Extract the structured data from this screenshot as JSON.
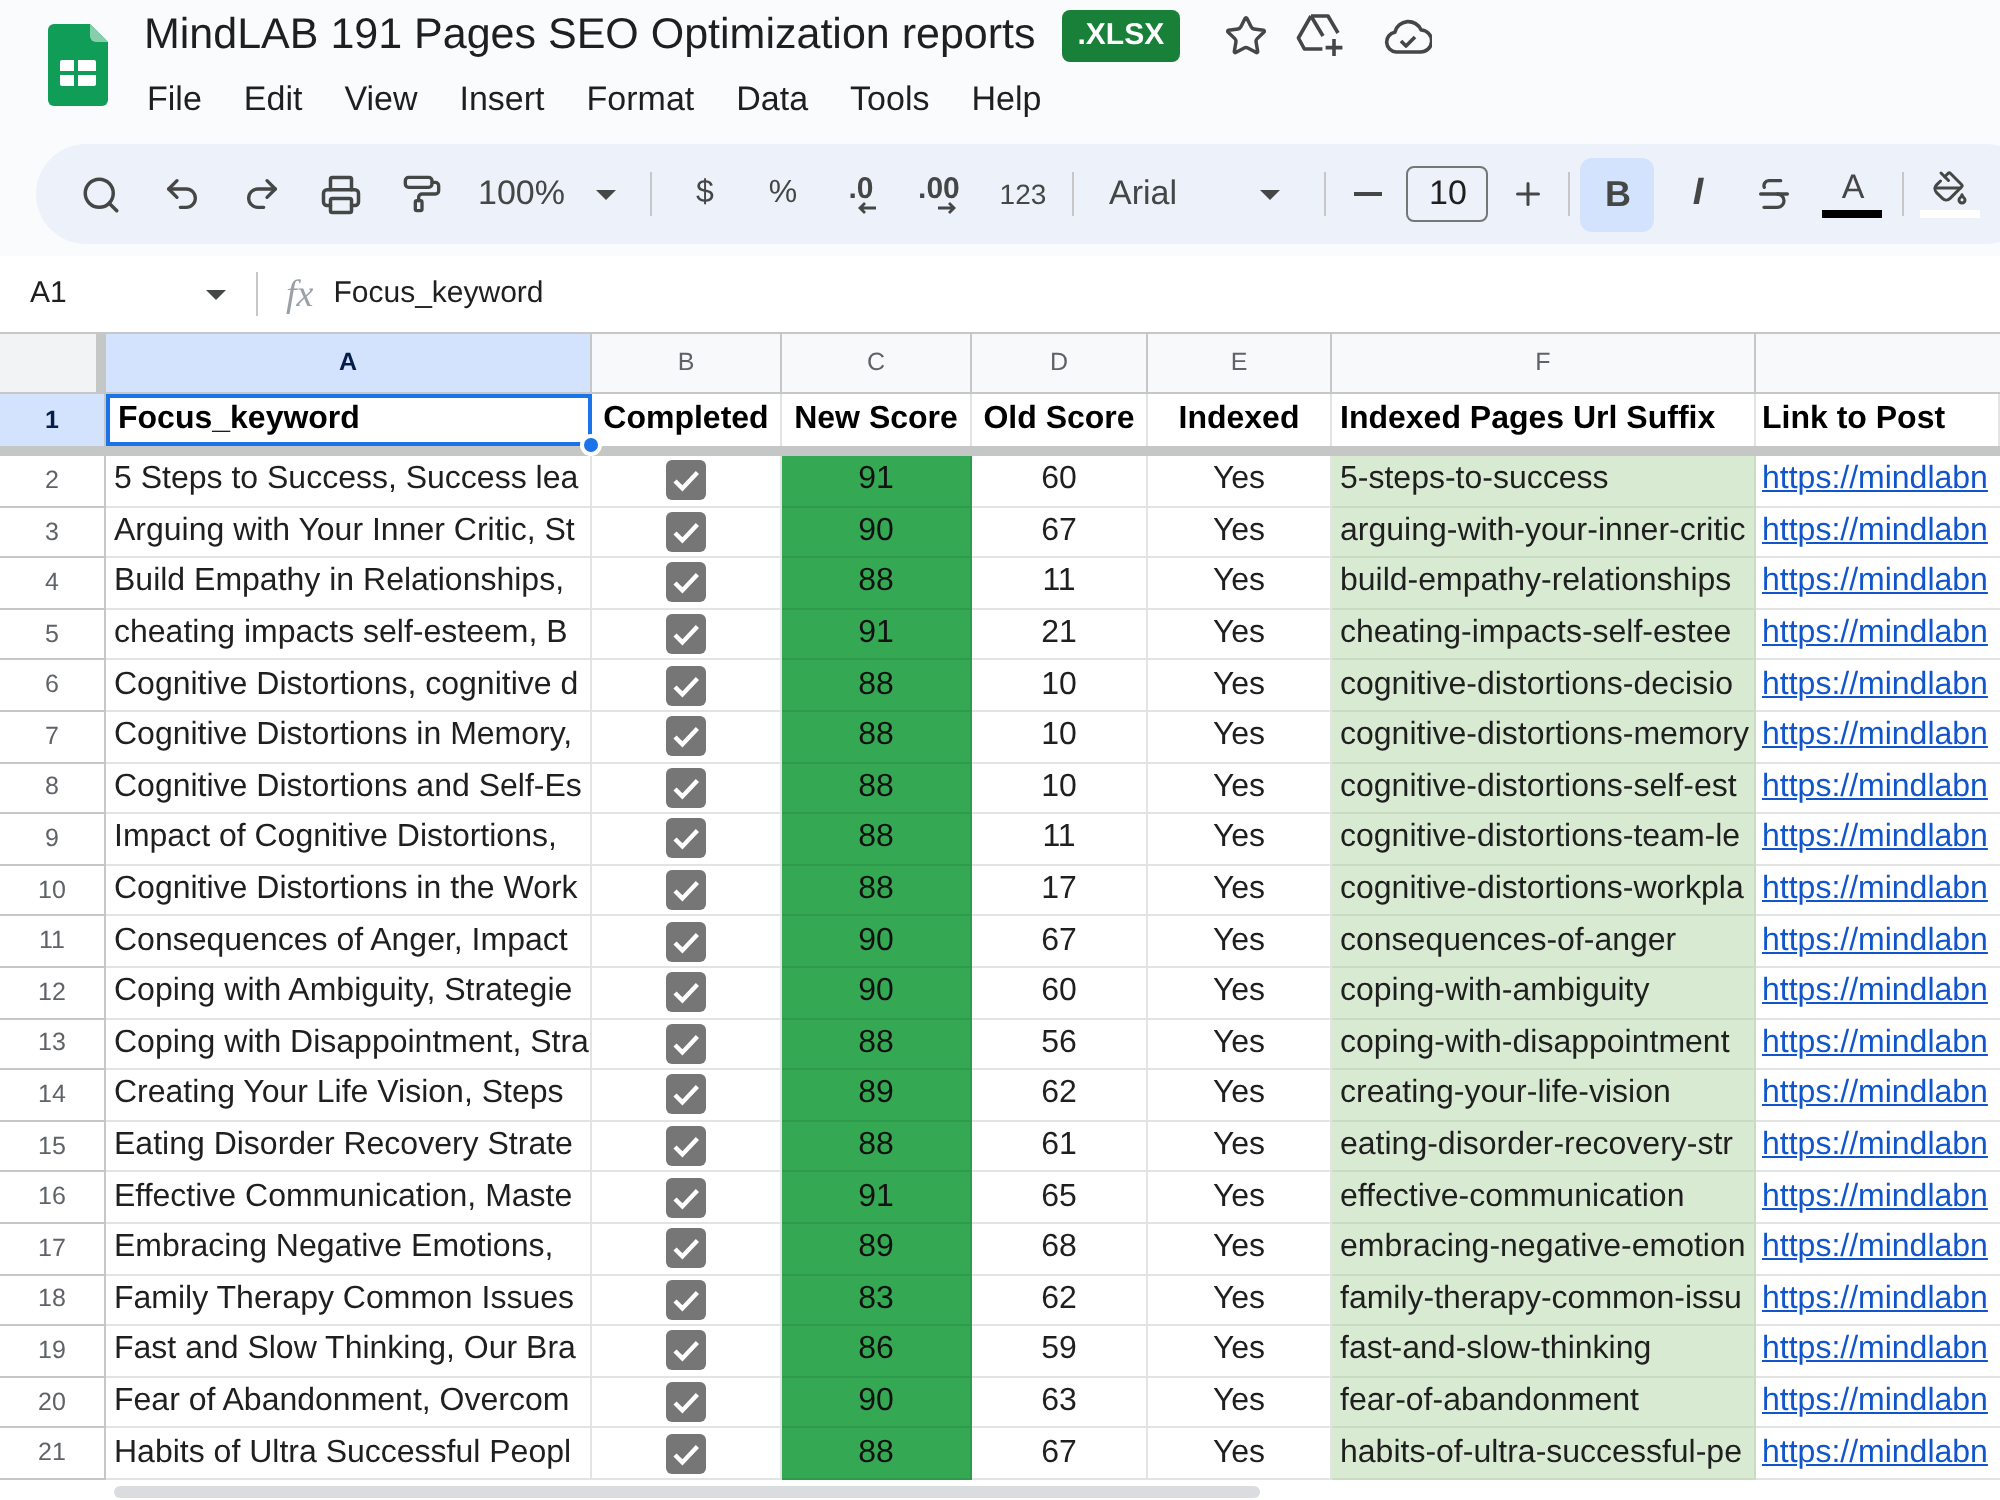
{
  "app": {
    "title": "MindLAB 191 Pages SEO Optimization reports",
    "file_badge": ".XLSX"
  },
  "menu": [
    "File",
    "Edit",
    "View",
    "Insert",
    "Format",
    "Data",
    "Tools",
    "Help"
  ],
  "toolbar": {
    "zoom": "100%",
    "currency": "$",
    "percent": "%",
    "decrease_decimal": ".0",
    "increase_decimal": ".00",
    "number_formats": "123",
    "font": "Arial",
    "font_size": "10",
    "bold": {
      "label": "B",
      "selected": true
    },
    "italic": {
      "label": "I",
      "selected": false
    },
    "strikethrough": {
      "selected": false
    },
    "text_color": "A"
  },
  "formula_bar": {
    "cell_ref": "A1",
    "function_label": "fx",
    "content": "Focus_keyword"
  },
  "sheet": {
    "columns": [
      {
        "letter": "A",
        "selected": true
      },
      {
        "letter": "B",
        "selected": false
      },
      {
        "letter": "C",
        "selected": false
      },
      {
        "letter": "D",
        "selected": false
      },
      {
        "letter": "E",
        "selected": false
      },
      {
        "letter": "F",
        "selected": false
      }
    ],
    "header_row": {
      "number": "1",
      "selected": true,
      "cells": [
        {
          "text": "Focus_keyword",
          "selected": true
        },
        {
          "text": "Completed",
          "selected": false
        },
        {
          "text": "New Score",
          "selected": false
        },
        {
          "text": "Old Score",
          "selected": false
        },
        {
          "text": "Indexed",
          "selected": false
        },
        {
          "text": "Indexed Pages Url Suffix",
          "selected": false
        },
        {
          "text": "Link to Post",
          "selected": false
        }
      ]
    },
    "rows": [
      {
        "number": "2",
        "selected": false,
        "keyword": "5 Steps to Success, Success lea",
        "completed": true,
        "new_score": "91",
        "old_score": "60",
        "indexed": "Yes",
        "url_suffix": "5-steps-to-success",
        "link": "https://mindlabn"
      },
      {
        "number": "3",
        "selected": false,
        "keyword": "Arguing with Your Inner Critic, St",
        "completed": true,
        "new_score": "90",
        "old_score": "67",
        "indexed": "Yes",
        "url_suffix": "arguing-with-your-inner-critic",
        "link": "https://mindlabn"
      },
      {
        "number": "4",
        "selected": false,
        "keyword": "Build Empathy in Relationships,",
        "completed": true,
        "new_score": "88",
        "old_score": "11",
        "indexed": "Yes",
        "url_suffix": "build-empathy-relationships",
        "link": "https://mindlabn"
      },
      {
        "number": "5",
        "selected": false,
        "keyword": "cheating impacts self-esteem, B",
        "completed": true,
        "new_score": "91",
        "old_score": "21",
        "indexed": "Yes",
        "url_suffix": "cheating-impacts-self-estee",
        "link": "https://mindlabn"
      },
      {
        "number": "6",
        "selected": false,
        "keyword": "Cognitive Distortions, cognitive d",
        "completed": true,
        "new_score": "88",
        "old_score": "10",
        "indexed": "Yes",
        "url_suffix": "cognitive-distortions-decisio",
        "link": "https://mindlabn"
      },
      {
        "number": "7",
        "selected": false,
        "keyword": "Cognitive Distortions in Memory,",
        "completed": true,
        "new_score": "88",
        "old_score": "10",
        "indexed": "Yes",
        "url_suffix": "cognitive-distortions-memory",
        "link": "https://mindlabn"
      },
      {
        "number": "8",
        "selected": false,
        "keyword": "Cognitive Distortions and Self-Es",
        "completed": true,
        "new_score": "88",
        "old_score": "10",
        "indexed": "Yes",
        "url_suffix": "cognitive-distortions-self-est",
        "link": "https://mindlabn"
      },
      {
        "number": "9",
        "selected": false,
        "keyword": "Impact of Cognitive Distortions,",
        "completed": true,
        "new_score": "88",
        "old_score": "11",
        "indexed": "Yes",
        "url_suffix": "cognitive-distortions-team-le",
        "link": "https://mindlabn"
      },
      {
        "number": "10",
        "selected": false,
        "keyword": "Cognitive Distortions in the Work",
        "completed": true,
        "new_score": "88",
        "old_score": "17",
        "indexed": "Yes",
        "url_suffix": "cognitive-distortions-workpla",
        "link": "https://mindlabn"
      },
      {
        "number": "11",
        "selected": false,
        "keyword": "Consequences of Anger, Impact",
        "completed": true,
        "new_score": "90",
        "old_score": "67",
        "indexed": "Yes",
        "url_suffix": "consequences-of-anger",
        "link": "https://mindlabn"
      },
      {
        "number": "12",
        "selected": false,
        "keyword": "Coping with Ambiguity, Strategie",
        "completed": true,
        "new_score": "90",
        "old_score": "60",
        "indexed": "Yes",
        "url_suffix": "coping-with-ambiguity",
        "link": "https://mindlabn"
      },
      {
        "number": "13",
        "selected": false,
        "keyword": "Coping with Disappointment, Stra",
        "completed": true,
        "new_score": "88",
        "old_score": "56",
        "indexed": "Yes",
        "url_suffix": "coping-with-disappointment",
        "link": "https://mindlabn"
      },
      {
        "number": "14",
        "selected": false,
        "keyword": "Creating Your Life Vision, Steps",
        "completed": true,
        "new_score": "89",
        "old_score": "62",
        "indexed": "Yes",
        "url_suffix": "creating-your-life-vision",
        "link": "https://mindlabn"
      },
      {
        "number": "15",
        "selected": false,
        "keyword": "Eating Disorder Recovery Strate",
        "completed": true,
        "new_score": "88",
        "old_score": "61",
        "indexed": "Yes",
        "url_suffix": "eating-disorder-recovery-str",
        "link": "https://mindlabn"
      },
      {
        "number": "16",
        "selected": false,
        "keyword": "Effective Communication, Maste",
        "completed": true,
        "new_score": "91",
        "old_score": "65",
        "indexed": "Yes",
        "url_suffix": "effective-communication",
        "link": "https://mindlabn"
      },
      {
        "number": "17",
        "selected": false,
        "keyword": "Embracing Negative Emotions,",
        "completed": true,
        "new_score": "89",
        "old_score": "68",
        "indexed": "Yes",
        "url_suffix": "embracing-negative-emotion",
        "link": "https://mindlabn"
      },
      {
        "number": "18",
        "selected": false,
        "keyword": "Family Therapy Common Issues",
        "completed": true,
        "new_score": "83",
        "old_score": "62",
        "indexed": "Yes",
        "url_suffix": "family-therapy-common-issu",
        "link": "https://mindlabn"
      },
      {
        "number": "19",
        "selected": false,
        "keyword": "Fast and Slow Thinking, Our Bra",
        "completed": true,
        "new_score": "86",
        "old_score": "59",
        "indexed": "Yes",
        "url_suffix": "fast-and-slow-thinking",
        "link": "https://mindlabn"
      },
      {
        "number": "20",
        "selected": false,
        "keyword": "Fear of Abandonment, Overcom",
        "completed": true,
        "new_score": "90",
        "old_score": "63",
        "indexed": "Yes",
        "url_suffix": "fear-of-abandonment",
        "link": "https://mindlabn"
      },
      {
        "number": "21",
        "selected": false,
        "keyword": "Habits of Ultra Successful Peopl",
        "completed": true,
        "new_score": "88",
        "old_score": "67",
        "indexed": "Yes",
        "url_suffix": "habits-of-ultra-successful-pe",
        "link": "https://mindlabn"
      }
    ]
  }
}
